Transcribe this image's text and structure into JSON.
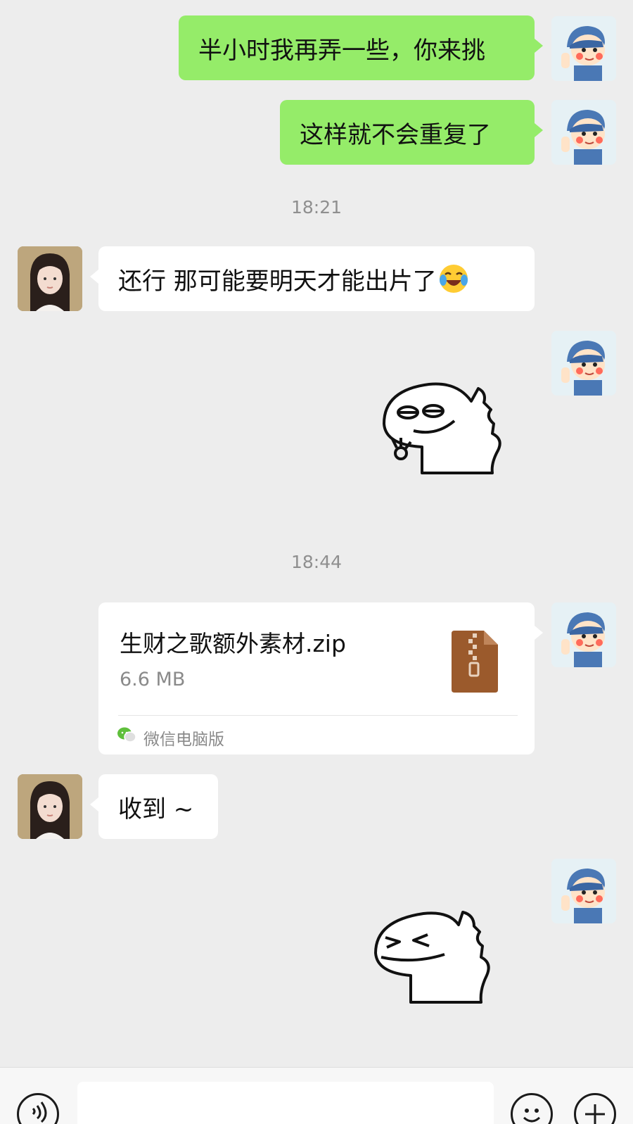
{
  "messages": [
    {
      "side": "right",
      "text": "半小时我再弄一些，你来挑"
    },
    {
      "side": "right",
      "text": "这样就不会重复了"
    },
    {
      "timestamp": "18:21"
    },
    {
      "side": "left",
      "text": "还行 那可能要明天才能出片了"
    },
    {
      "side": "right",
      "type": "sticker",
      "sticker": "dinosaur-ok-sticker"
    },
    {
      "timestamp": "18:44"
    },
    {
      "side": "right",
      "type": "file",
      "file_name": "生财之歌额外素材.zip",
      "file_size": "6.6 MB",
      "source": "微信电脑版"
    },
    {
      "side": "left",
      "text": "收到 ~"
    },
    {
      "side": "right",
      "type": "sticker",
      "sticker": "dinosaur-grin-sticker"
    }
  ],
  "colors": {
    "background": "#ededed",
    "sent_bubble": "#95ec69",
    "received_bubble": "#ffffff",
    "file_icon": "#9b5a2c",
    "wechat_green": "#5fbf3b"
  },
  "icons": {
    "voice": "voice-icon",
    "emoji": "emoji-icon",
    "add": "plus-icon",
    "crying_laugh": "crying-laughing-emoji"
  }
}
